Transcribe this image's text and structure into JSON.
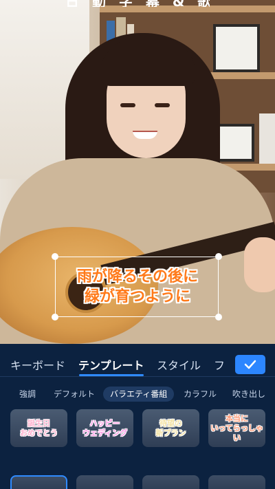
{
  "photo": {
    "title_strip": "日 動 字 幕 & 歌 詞"
  },
  "caption": {
    "line1": "雨が降るその後に",
    "line2": "緑が育つように",
    "color": "#ff7a1a"
  },
  "panel": {
    "tabs": [
      {
        "label": "キーボード"
      },
      {
        "label": "テンプレート"
      },
      {
        "label": "スタイル"
      },
      {
        "label": "フ"
      }
    ],
    "active_tab": "テンプレート",
    "confirm_icon": "checkmark-icon",
    "chips": [
      {
        "label": "強調"
      },
      {
        "label": "デフォルト"
      },
      {
        "label": "バラエティ番組"
      },
      {
        "label": "カラフル"
      },
      {
        "label": "吹き出し"
      }
    ],
    "active_chip": "バラエティ番組",
    "templates": [
      {
        "text": "誕生日\nおめでとう",
        "color": "#ffb3d0"
      },
      {
        "text": "ハッピー\nウェディング",
        "color": "#ff9be6"
      },
      {
        "text": "待望の\n新プラン",
        "color": "#f4e3a6"
      },
      {
        "text": "本当に\nいってらっしゃい",
        "color": "#ff9c7a"
      }
    ]
  }
}
